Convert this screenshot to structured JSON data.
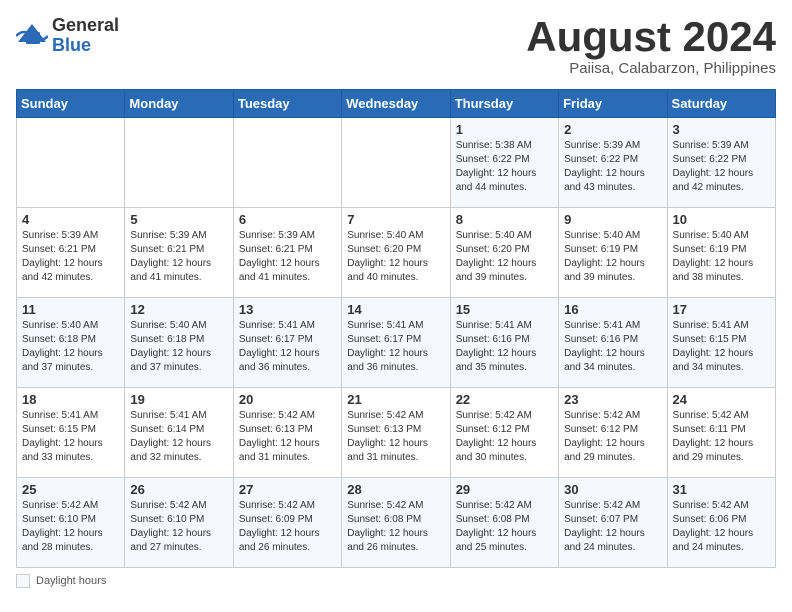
{
  "header": {
    "logo_general": "General",
    "logo_blue": "Blue",
    "month_year": "August 2024",
    "location": "Paiisa, Calabarzon, Philippines"
  },
  "days_of_week": [
    "Sunday",
    "Monday",
    "Tuesday",
    "Wednesday",
    "Thursday",
    "Friday",
    "Saturday"
  ],
  "footer": {
    "daylight_label": "Daylight hours"
  },
  "weeks": [
    [
      {
        "day": "",
        "info": ""
      },
      {
        "day": "",
        "info": ""
      },
      {
        "day": "",
        "info": ""
      },
      {
        "day": "",
        "info": ""
      },
      {
        "day": "1",
        "info": "Sunrise: 5:38 AM\nSunset: 6:22 PM\nDaylight: 12 hours\nand 44 minutes."
      },
      {
        "day": "2",
        "info": "Sunrise: 5:39 AM\nSunset: 6:22 PM\nDaylight: 12 hours\nand 43 minutes."
      },
      {
        "day": "3",
        "info": "Sunrise: 5:39 AM\nSunset: 6:22 PM\nDaylight: 12 hours\nand 42 minutes."
      }
    ],
    [
      {
        "day": "4",
        "info": "Sunrise: 5:39 AM\nSunset: 6:21 PM\nDaylight: 12 hours\nand 42 minutes."
      },
      {
        "day": "5",
        "info": "Sunrise: 5:39 AM\nSunset: 6:21 PM\nDaylight: 12 hours\nand 41 minutes."
      },
      {
        "day": "6",
        "info": "Sunrise: 5:39 AM\nSunset: 6:21 PM\nDaylight: 12 hours\nand 41 minutes."
      },
      {
        "day": "7",
        "info": "Sunrise: 5:40 AM\nSunset: 6:20 PM\nDaylight: 12 hours\nand 40 minutes."
      },
      {
        "day": "8",
        "info": "Sunrise: 5:40 AM\nSunset: 6:20 PM\nDaylight: 12 hours\nand 39 minutes."
      },
      {
        "day": "9",
        "info": "Sunrise: 5:40 AM\nSunset: 6:19 PM\nDaylight: 12 hours\nand 39 minutes."
      },
      {
        "day": "10",
        "info": "Sunrise: 5:40 AM\nSunset: 6:19 PM\nDaylight: 12 hours\nand 38 minutes."
      }
    ],
    [
      {
        "day": "11",
        "info": "Sunrise: 5:40 AM\nSunset: 6:18 PM\nDaylight: 12 hours\nand 37 minutes."
      },
      {
        "day": "12",
        "info": "Sunrise: 5:40 AM\nSunset: 6:18 PM\nDaylight: 12 hours\nand 37 minutes."
      },
      {
        "day": "13",
        "info": "Sunrise: 5:41 AM\nSunset: 6:17 PM\nDaylight: 12 hours\nand 36 minutes."
      },
      {
        "day": "14",
        "info": "Sunrise: 5:41 AM\nSunset: 6:17 PM\nDaylight: 12 hours\nand 36 minutes."
      },
      {
        "day": "15",
        "info": "Sunrise: 5:41 AM\nSunset: 6:16 PM\nDaylight: 12 hours\nand 35 minutes."
      },
      {
        "day": "16",
        "info": "Sunrise: 5:41 AM\nSunset: 6:16 PM\nDaylight: 12 hours\nand 34 minutes."
      },
      {
        "day": "17",
        "info": "Sunrise: 5:41 AM\nSunset: 6:15 PM\nDaylight: 12 hours\nand 34 minutes."
      }
    ],
    [
      {
        "day": "18",
        "info": "Sunrise: 5:41 AM\nSunset: 6:15 PM\nDaylight: 12 hours\nand 33 minutes."
      },
      {
        "day": "19",
        "info": "Sunrise: 5:41 AM\nSunset: 6:14 PM\nDaylight: 12 hours\nand 32 minutes."
      },
      {
        "day": "20",
        "info": "Sunrise: 5:42 AM\nSunset: 6:13 PM\nDaylight: 12 hours\nand 31 minutes."
      },
      {
        "day": "21",
        "info": "Sunrise: 5:42 AM\nSunset: 6:13 PM\nDaylight: 12 hours\nand 31 minutes."
      },
      {
        "day": "22",
        "info": "Sunrise: 5:42 AM\nSunset: 6:12 PM\nDaylight: 12 hours\nand 30 minutes."
      },
      {
        "day": "23",
        "info": "Sunrise: 5:42 AM\nSunset: 6:12 PM\nDaylight: 12 hours\nand 29 minutes."
      },
      {
        "day": "24",
        "info": "Sunrise: 5:42 AM\nSunset: 6:11 PM\nDaylight: 12 hours\nand 29 minutes."
      }
    ],
    [
      {
        "day": "25",
        "info": "Sunrise: 5:42 AM\nSunset: 6:10 PM\nDaylight: 12 hours\nand 28 minutes."
      },
      {
        "day": "26",
        "info": "Sunrise: 5:42 AM\nSunset: 6:10 PM\nDaylight: 12 hours\nand 27 minutes."
      },
      {
        "day": "27",
        "info": "Sunrise: 5:42 AM\nSunset: 6:09 PM\nDaylight: 12 hours\nand 26 minutes."
      },
      {
        "day": "28",
        "info": "Sunrise: 5:42 AM\nSunset: 6:08 PM\nDaylight: 12 hours\nand 26 minutes."
      },
      {
        "day": "29",
        "info": "Sunrise: 5:42 AM\nSunset: 6:08 PM\nDaylight: 12 hours\nand 25 minutes."
      },
      {
        "day": "30",
        "info": "Sunrise: 5:42 AM\nSunset: 6:07 PM\nDaylight: 12 hours\nand 24 minutes."
      },
      {
        "day": "31",
        "info": "Sunrise: 5:42 AM\nSunset: 6:06 PM\nDaylight: 12 hours\nand 24 minutes."
      }
    ]
  ]
}
